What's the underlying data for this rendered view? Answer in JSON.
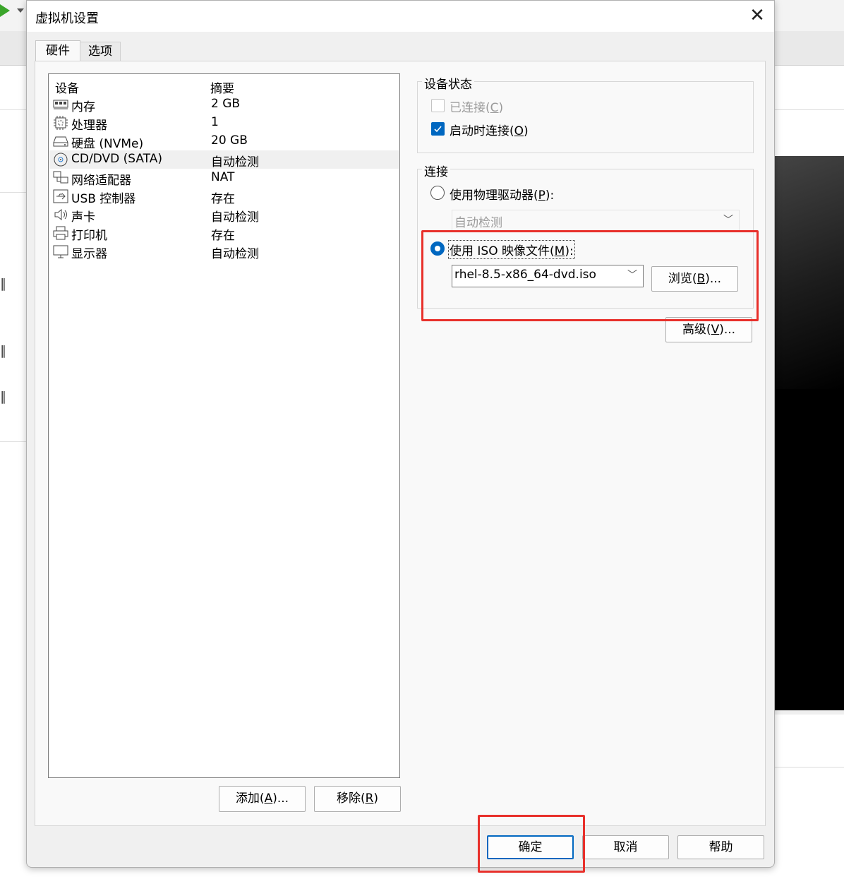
{
  "colors": {
    "accent": "#0067c0",
    "highlight_box": "#e8302b",
    "play": "#3aa52a"
  },
  "dialog": {
    "title": "虚拟机设置",
    "close_icon": "close-icon",
    "tabs": [
      {
        "label": "硬件"
      },
      {
        "label": "选项"
      }
    ]
  },
  "device_list": {
    "col_device": "设备",
    "col_summary": "摘要",
    "rows": [
      {
        "icon": "memory-icon",
        "name": "内存",
        "summary": "2 GB"
      },
      {
        "icon": "processor-icon",
        "name": "处理器",
        "summary": "1"
      },
      {
        "icon": "hard-disk-icon",
        "name": "硬盘 (NVMe)",
        "summary": "20 GB"
      },
      {
        "icon": "cd-dvd-icon",
        "name": "CD/DVD (SATA)",
        "summary": "自动检测",
        "selected": true
      },
      {
        "icon": "network-adapter-icon",
        "name": "网络适配器",
        "summary": "NAT"
      },
      {
        "icon": "usb-icon",
        "name": "USB 控制器",
        "summary": "存在"
      },
      {
        "icon": "sound-icon",
        "name": "声卡",
        "summary": "自动检测"
      },
      {
        "icon": "printer-icon",
        "name": "打印机",
        "summary": "存在"
      },
      {
        "icon": "display-icon",
        "name": "显示器",
        "summary": "自动检测"
      }
    ],
    "add_button": {
      "text": "添加(",
      "key": "A",
      "tail": ")..."
    },
    "remove_button": {
      "text": "移除(",
      "key": "R",
      "tail": ")"
    }
  },
  "device_status": {
    "label": "设备状态",
    "connected": {
      "text": "已连接(",
      "key": "C",
      "tail": ")",
      "checked": false,
      "enabled": false
    },
    "connect_at_power_on": {
      "text": "启动时连接(",
      "key": "O",
      "tail": ")",
      "checked": true
    }
  },
  "connection": {
    "label": "连接",
    "physical": {
      "text": "使用物理驱动器(",
      "key": "P",
      "tail": "):",
      "selected": false
    },
    "physical_value": "自动检测",
    "iso": {
      "text": "使用 ISO 映像文件(",
      "key": "M",
      "tail": "):",
      "selected": true
    },
    "iso_value": "rhel-8.5-x86_64-dvd.iso",
    "browse_button": {
      "text": "浏览(",
      "key": "B",
      "tail": ")..."
    }
  },
  "advanced_button": {
    "text": "高级(",
    "key": "V",
    "tail": ")..."
  },
  "footer": {
    "ok": "确定",
    "cancel": "取消",
    "help": "帮助"
  }
}
